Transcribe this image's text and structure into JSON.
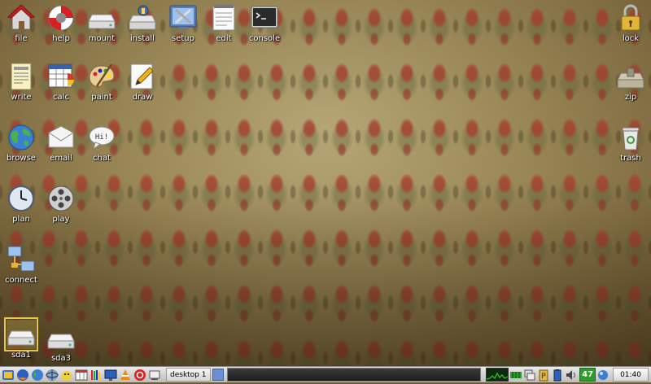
{
  "desktop": {
    "icons": {
      "file": {
        "label": "file",
        "icon": "home-icon"
      },
      "help": {
        "label": "help",
        "icon": "lifebuoy-icon"
      },
      "mount": {
        "label": "mount",
        "icon": "drive-icon"
      },
      "install": {
        "label": "install",
        "icon": "package-icon"
      },
      "setup": {
        "label": "setup",
        "icon": "settings-icon"
      },
      "edit": {
        "label": "edit",
        "icon": "notepad-icon"
      },
      "console": {
        "label": "console",
        "icon": "terminal-icon"
      },
      "lock": {
        "label": "lock",
        "icon": "padlock-icon"
      },
      "write": {
        "label": "write",
        "icon": "document-icon"
      },
      "calc": {
        "label": "calc",
        "icon": "spreadsheet-icon"
      },
      "paint": {
        "label": "paint",
        "icon": "palette-icon"
      },
      "draw": {
        "label": "draw",
        "icon": "pencil-icon"
      },
      "zip": {
        "label": "zip",
        "icon": "archive-icon"
      },
      "browse": {
        "label": "browse",
        "icon": "globe-icon"
      },
      "email": {
        "label": "email",
        "icon": "envelope-icon"
      },
      "chat": {
        "label": "chat",
        "icon": "speech-bubble-icon",
        "bubble_text": "Hi!"
      },
      "trash": {
        "label": "trash",
        "icon": "trash-icon"
      },
      "plan": {
        "label": "plan",
        "icon": "clock-icon"
      },
      "play": {
        "label": "play",
        "icon": "film-reel-icon"
      },
      "connect": {
        "label": "connect",
        "icon": "network-icon"
      },
      "sda1": {
        "label": "sda1",
        "icon": "drive-icon",
        "selected": true
      },
      "sda3": {
        "label": "sda3",
        "icon": "drive-icon"
      }
    }
  },
  "taskbar": {
    "desktop_label": "desktop 1",
    "battery": "47",
    "clock": "01:40"
  },
  "colors": {
    "accent": "#e2c94e",
    "taskbar_bg": "#d4d4d4",
    "battery": "#2a9d2a"
  }
}
